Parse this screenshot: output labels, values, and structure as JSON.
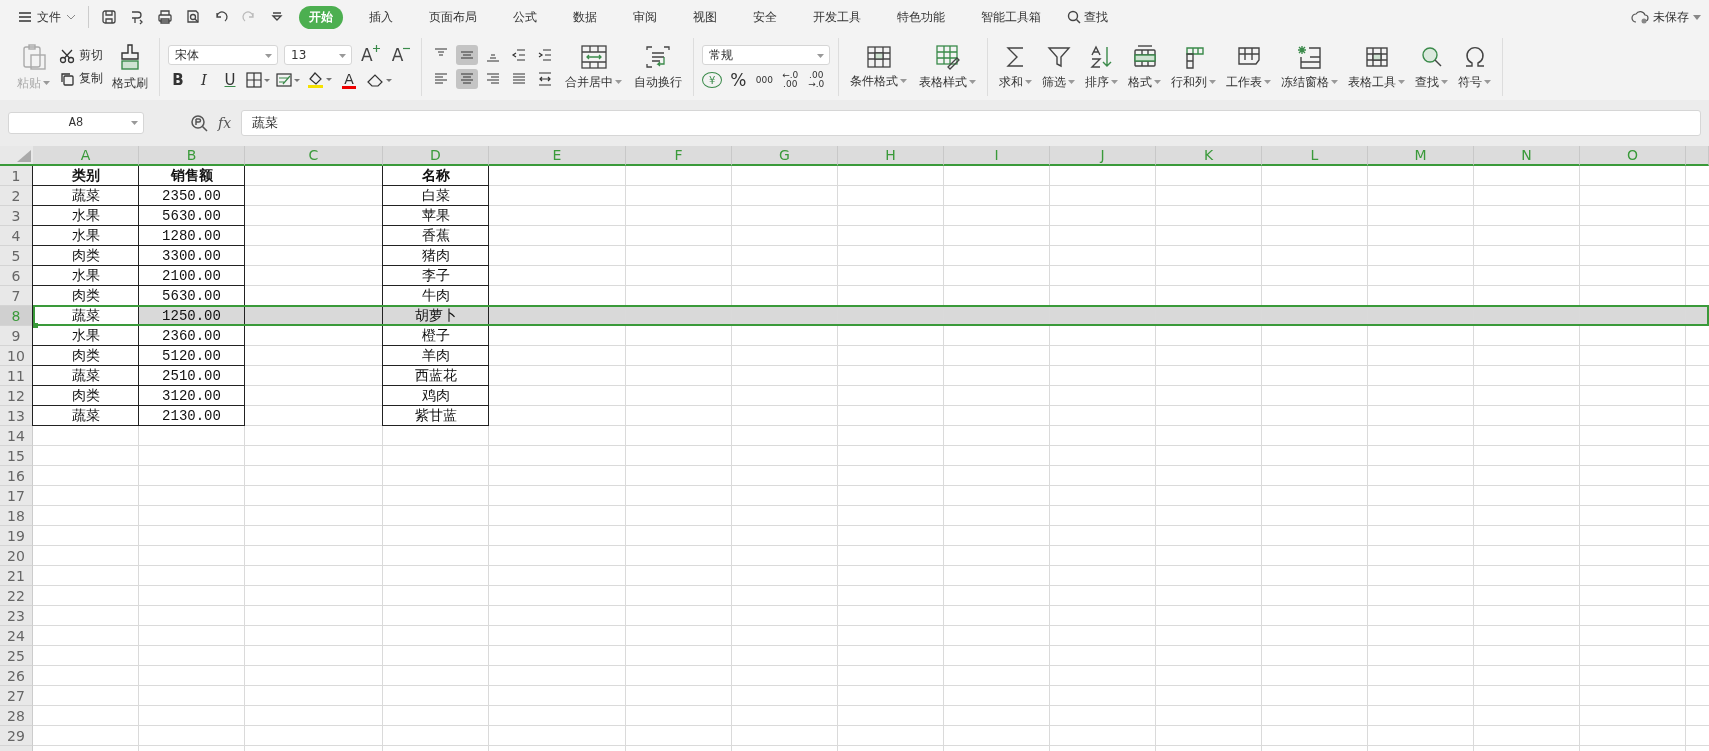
{
  "menu": {
    "file": "文件",
    "quick_access": [
      {
        "kind": "save",
        "disabled": false
      },
      {
        "kind": "export",
        "disabled": false
      },
      {
        "kind": "print",
        "disabled": false
      },
      {
        "kind": "preview",
        "disabled": false
      },
      {
        "kind": "undo",
        "disabled": false
      },
      {
        "kind": "redo",
        "disabled": true
      },
      {
        "kind": "more",
        "disabled": false
      }
    ],
    "tabs": [
      {
        "label": "开始",
        "selected": true
      },
      {
        "label": "插入",
        "selected": false
      },
      {
        "label": "页面布局",
        "selected": false
      },
      {
        "label": "公式",
        "selected": false
      },
      {
        "label": "数据",
        "selected": false
      },
      {
        "label": "审阅",
        "selected": false
      },
      {
        "label": "视图",
        "selected": false
      },
      {
        "label": "安全",
        "selected": false
      },
      {
        "label": "开发工具",
        "selected": false
      },
      {
        "label": "特色功能",
        "selected": false
      },
      {
        "label": "智能工具箱",
        "selected": false
      }
    ],
    "search": "查找",
    "save_status": "未保存"
  },
  "ribbon": {
    "paste": {
      "label": "粘贴",
      "disabled": true
    },
    "cut": "剪切",
    "copy": "复制",
    "format_painter": "格式刷",
    "font_name": "宋体",
    "font_size": "13",
    "size_buttons": [
      {
        "kind": "grow",
        "label": "A"
      },
      {
        "kind": "shrink",
        "label": "A"
      }
    ],
    "style_buttons": [
      {
        "kind": "bold",
        "label": "B"
      },
      {
        "kind": "italic",
        "label": "I"
      },
      {
        "kind": "underline",
        "label": "U"
      }
    ],
    "font_color": "A",
    "align_buttons": [
      {
        "kind": "top",
        "selected": false
      },
      {
        "kind": "middle",
        "selected": true
      },
      {
        "kind": "bottom",
        "selected": false
      },
      {
        "kind": "outdent",
        "selected": false
      },
      {
        "kind": "indent",
        "selected": false
      },
      {
        "kind": "left",
        "selected": false
      },
      {
        "kind": "center",
        "selected": true
      },
      {
        "kind": "right",
        "selected": false
      },
      {
        "kind": "justify",
        "selected": false
      },
      {
        "kind": "distribute",
        "selected": false
      }
    ],
    "merge": "合并居中",
    "wrap": "自动换行",
    "number_format": "常规",
    "number_buttons": [
      {
        "kind": "currency",
        "lines": [
          "¥"
        ]
      },
      {
        "kind": "percent",
        "lines": [
          "%"
        ]
      },
      {
        "kind": "thousands",
        "lines": [
          "000"
        ]
      },
      {
        "kind": "add_decimal",
        "lines": [
          "←.0",
          ".00"
        ]
      },
      {
        "kind": "remove_decimal",
        "lines": [
          ".00",
          "→.0"
        ]
      }
    ],
    "conditional_format": "条件格式",
    "table_style": "表格样式",
    "tools": [
      {
        "kind": "sum",
        "label": "求和"
      },
      {
        "kind": "filter",
        "label": "筛选"
      },
      {
        "kind": "sort",
        "label": "排序"
      },
      {
        "kind": "format",
        "label": "格式"
      },
      {
        "kind": "rows_cols",
        "label": "行和列"
      },
      {
        "kind": "sheet",
        "label": "工作表"
      },
      {
        "kind": "freeze",
        "label": "冻结窗格"
      },
      {
        "kind": "table_tools",
        "label": "表格工具"
      },
      {
        "kind": "find",
        "label": "查找"
      },
      {
        "kind": "symbol",
        "label": "符号"
      }
    ]
  },
  "formula_bar": {
    "cell_ref": "A8",
    "fx": "fx",
    "value": "蔬菜"
  },
  "sheet": {
    "columns": [
      "A",
      "B",
      "C",
      "D",
      "E",
      "F",
      "G",
      "H",
      "I",
      "J",
      "K",
      "L",
      "M",
      "N",
      "O"
    ],
    "rows": [
      {
        "number": "1",
        "selected": false,
        "kind": "header",
        "cells": {
          "A": "类别",
          "B": "销售额",
          "D": "名称"
        }
      },
      {
        "number": "2",
        "selected": false,
        "kind": "data",
        "cells": {
          "A": "蔬菜",
          "B": "2350.00",
          "D": "白菜"
        }
      },
      {
        "number": "3",
        "selected": false,
        "kind": "data",
        "cells": {
          "A": "水果",
          "B": "5630.00",
          "D": "苹果"
        }
      },
      {
        "number": "4",
        "selected": false,
        "kind": "data",
        "cells": {
          "A": "水果",
          "B": "1280.00",
          "D": "香蕉"
        }
      },
      {
        "number": "5",
        "selected": false,
        "kind": "data",
        "cells": {
          "A": "肉类",
          "B": "3300.00",
          "D": "猪肉"
        }
      },
      {
        "number": "6",
        "selected": false,
        "kind": "data",
        "cells": {
          "A": "水果",
          "B": "2100.00",
          "D": "李子"
        }
      },
      {
        "number": "7",
        "selected": false,
        "kind": "data",
        "cells": {
          "A": "肉类",
          "B": "5630.00",
          "D": "牛肉"
        }
      },
      {
        "number": "8",
        "selected": true,
        "kind": "data",
        "cells": {
          "A": "蔬菜",
          "B": "1250.00",
          "D": "胡萝卜"
        }
      },
      {
        "number": "9",
        "selected": false,
        "kind": "data",
        "cells": {
          "A": "水果",
          "B": "2360.00",
          "D": "橙子"
        }
      },
      {
        "number": "10",
        "selected": false,
        "kind": "data",
        "cells": {
          "A": "肉类",
          "B": "5120.00",
          "D": "羊肉"
        }
      },
      {
        "number": "11",
        "selected": false,
        "kind": "data",
        "cells": {
          "A": "蔬菜",
          "B": "2510.00",
          "D": "西蓝花"
        }
      },
      {
        "number": "12",
        "selected": false,
        "kind": "data",
        "cells": {
          "A": "肉类",
          "B": "3120.00",
          "D": "鸡肉"
        }
      },
      {
        "number": "13",
        "selected": false,
        "kind": "data",
        "cells": {
          "A": "蔬菜",
          "B": "2130.00",
          "D": "紫甘蓝"
        }
      },
      {
        "number": "14",
        "selected": false
      },
      {
        "number": "15",
        "selected": false
      },
      {
        "number": "16",
        "selected": false
      },
      {
        "number": "17",
        "selected": false
      },
      {
        "number": "18",
        "selected": false
      },
      {
        "number": "19",
        "selected": false
      },
      {
        "number": "20",
        "selected": false
      },
      {
        "number": "21",
        "selected": false
      },
      {
        "number": "22",
        "selected": false
      },
      {
        "number": "23",
        "selected": false
      },
      {
        "number": "24",
        "selected": false
      },
      {
        "number": "25",
        "selected": false
      },
      {
        "number": "26",
        "selected": false
      },
      {
        "number": "27",
        "selected": false
      },
      {
        "number": "28",
        "selected": false
      },
      {
        "number": "29",
        "selected": false
      }
    ]
  }
}
